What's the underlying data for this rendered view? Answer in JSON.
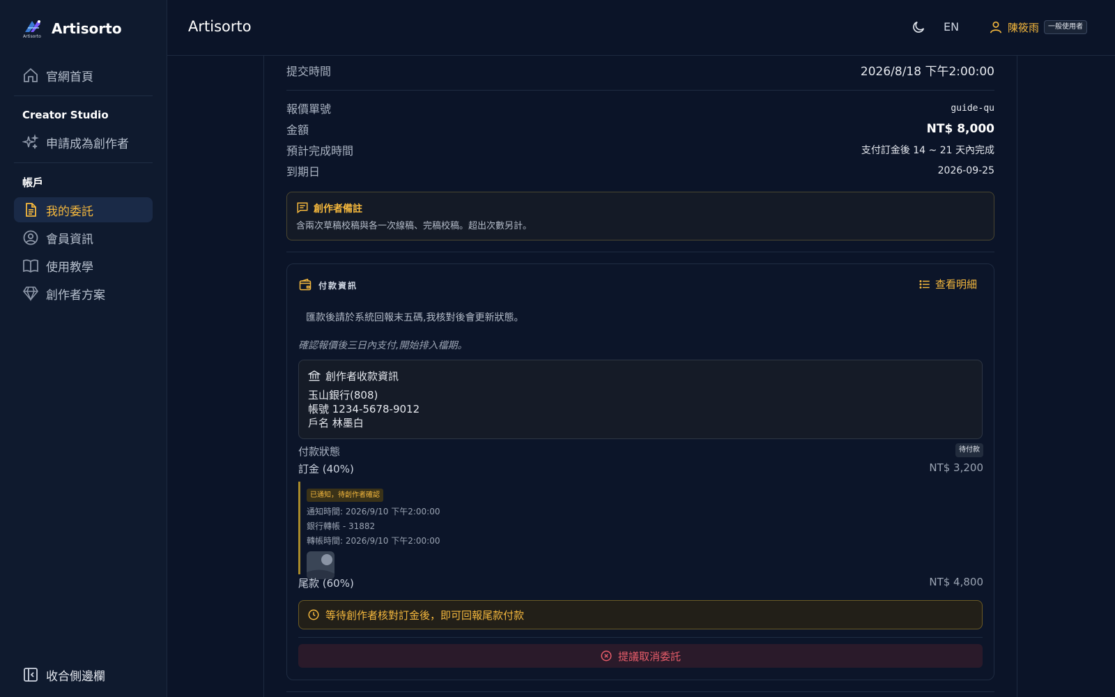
{
  "brand": {
    "name": "Artisorto",
    "logo_sub": "Artisorto"
  },
  "sidebar": {
    "home": "官網首頁",
    "creator_studio_title": "Creator Studio",
    "apply_creator": "申請成為創作者",
    "account_title": "帳戶",
    "my_commissions": "我的委託",
    "member_info": "會員資訊",
    "tutorial": "使用教學",
    "creator_plan": "創作者方案",
    "collapse": "收合側邊欄"
  },
  "topbar": {
    "title": "Artisorto",
    "lang": "EN",
    "user_name": "陳筱雨",
    "role": "一般使用者"
  },
  "details": {
    "submit_time_label": "提交時間",
    "submit_time_value": "2026/8/18 下午2:00:00",
    "quote_no_label": "報價單號",
    "quote_no_value": "guide-qu",
    "amount_label": "金額",
    "amount_value": "NT$ 8,000",
    "eta_label": "預計完成時間",
    "eta_value": "支付訂金後 14 ~ 21 天內完成",
    "due_label": "到期日",
    "due_value": "2026-09-25"
  },
  "creator_note": {
    "title": "創作者備註",
    "text": "含兩次草稿校稿與各一次線稿、完稿校稿。超出次數另計。"
  },
  "payment": {
    "title": "付款資訊",
    "view_detail": "查看明細",
    "instruction": "匯款後請於系統回報末五碼,我核對後會更新狀態。",
    "note_italic": "確認報價後三日內支付,開始排入檔期。",
    "bank": {
      "title": "創作者收款資訊",
      "bank_name": "玉山銀行(808)",
      "account": "帳號 1234-5678-9012",
      "holder": "戶名 林墨白"
    },
    "status_label": "付款狀態",
    "status_value": "待付款",
    "deposit_label": "訂金 (40%)",
    "deposit_value": "NT$ 3,200",
    "deposit_badge": "已通知，待創作者確認",
    "notify_time": "通知時間: 2026/9/10 下午2:00:00",
    "transfer_method": "銀行轉帳 - 31882",
    "transfer_time": "轉帳時間: 2026/9/10 下午2:00:00",
    "final_label": "尾款 (60%)",
    "final_value": "NT$ 4,800",
    "wait_msg": "等待創作者核對訂金後，即可回報尾款付款",
    "cancel_btn": "提議取消委託"
  },
  "colors": {
    "accent": "#f5b83d",
    "danger": "#e85d6a",
    "bg": "#0b1428"
  }
}
